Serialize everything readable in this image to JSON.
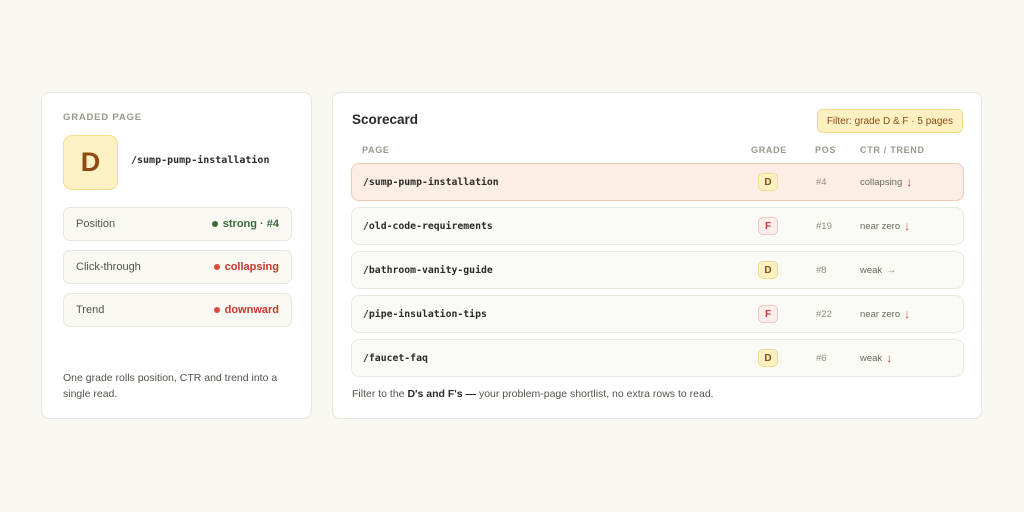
{
  "graded": {
    "eyebrow": "GRADED PAGE",
    "grade": "D",
    "path": "/sump-pump-installation",
    "metrics": [
      {
        "label": "Position",
        "value": "strong · #4",
        "status": "good"
      },
      {
        "label": "Click-through",
        "value": "collapsing",
        "status": "bad"
      },
      {
        "label": "Trend",
        "value": "downward",
        "status": "bad"
      }
    ],
    "note": "One grade rolls position, CTR and trend into a single read."
  },
  "scorecard": {
    "title": "Scorecard",
    "filter_label": "Filter: grade D & F · 5 pages",
    "columns": {
      "page": "PAGE",
      "grade": "GRADE",
      "pos": "POS",
      "ctr": "CTR / TREND"
    },
    "rows": [
      {
        "path": "/sump-pump-installation",
        "grade": "D",
        "pos": "#4",
        "ctr": "collapsing",
        "trend": "down",
        "trend_glyph": "↓",
        "highlighted": true
      },
      {
        "path": "/old-code-requirements",
        "grade": "F",
        "pos": "#19",
        "ctr": "near zero",
        "trend": "down",
        "trend_glyph": "↓",
        "highlighted": false
      },
      {
        "path": "/bathroom-vanity-guide",
        "grade": "D",
        "pos": "#8",
        "ctr": "weak",
        "trend": "flat",
        "trend_glyph": "→",
        "highlighted": false
      },
      {
        "path": "/pipe-insulation-tips",
        "grade": "F",
        "pos": "#22",
        "ctr": "near zero",
        "trend": "down",
        "trend_glyph": "↓",
        "highlighted": false
      },
      {
        "path": "/faucet-faq",
        "grade": "D",
        "pos": "#6",
        "ctr": "weak",
        "trend": "down",
        "trend_glyph": "↓",
        "highlighted": false
      }
    ],
    "footer": {
      "prefix": "Filter to the ",
      "emphasis": "D's and F's —",
      "suffix": " your problem-page shortlist, no extra rows to read."
    }
  },
  "colors": {
    "background": "#f8f7f2",
    "grade_d_bg": "#fdf1c4",
    "grade_d_text": "#8e4a12",
    "grade_f_text": "#c8372c",
    "good": "#3a6a3c",
    "bad": "#c8372c",
    "highlight_row": "#fdeee5"
  }
}
